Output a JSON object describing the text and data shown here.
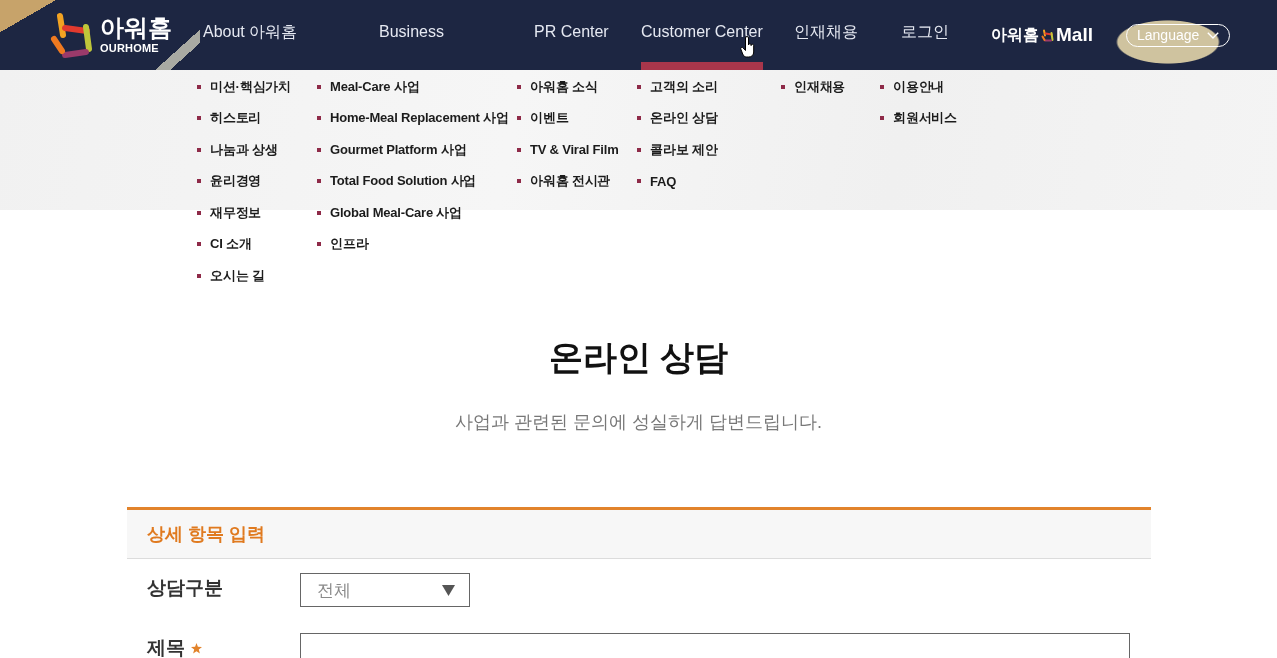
{
  "header": {
    "logo": {
      "name": "아워홈",
      "tagline": "OURHOME"
    },
    "nav": [
      {
        "label": "About 아워홈",
        "selected": false
      },
      {
        "label": "Business",
        "selected": false
      },
      {
        "label": "PR Center",
        "selected": false
      },
      {
        "label": "Customer Center",
        "selected": true
      },
      {
        "label": "인재채용",
        "selected": false
      },
      {
        "label": "로그인",
        "selected": false
      }
    ],
    "mall": {
      "brand": "아워홈",
      "label": "Mall"
    },
    "language": {
      "label": "Language"
    }
  },
  "mega_menu": [
    [
      "미션·핵심가치",
      "히스토리",
      "나눔과 상생",
      "윤리경영",
      "재무정보",
      "CI 소개",
      "오시는 길"
    ],
    [
      "Meal-Care 사업",
      "Home-Meal Replacement 사업",
      "Gourmet Platform 사업",
      "Total Food Solution 사업",
      "Global Meal-Care 사업",
      "인프라"
    ],
    [
      "아워홈 소식",
      "이벤트",
      "TV & Viral Film",
      "아워홈 전시관"
    ],
    [
      "고객의 소리",
      "온라인 상담",
      "콜라보 제안",
      "FAQ"
    ],
    [
      "인재채용"
    ],
    [
      "이용안내",
      "회원서비스"
    ]
  ],
  "page": {
    "title": "온라인 상담",
    "subtitle": "사업과 관련된 문의에 성실하게 답변드립니다."
  },
  "form": {
    "section_title": "상세 항목 입력",
    "fields": [
      {
        "kind": "select",
        "label": "상담구분",
        "value": "전체",
        "required": false
      },
      {
        "kind": "text",
        "label": "제목",
        "required": true
      }
    ]
  }
}
